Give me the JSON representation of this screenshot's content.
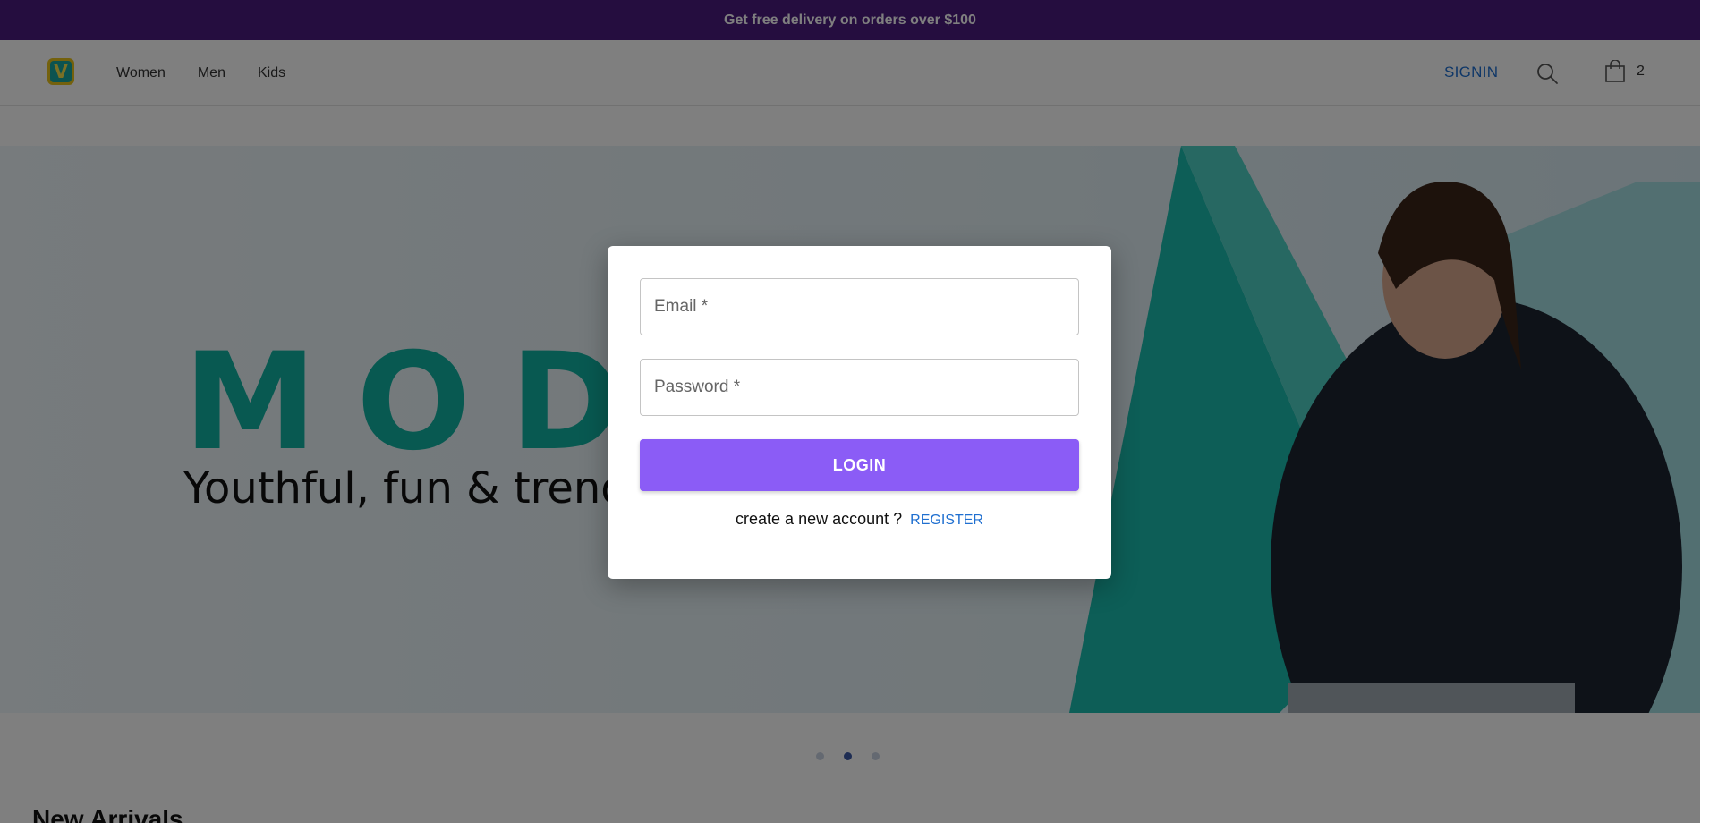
{
  "promo": {
    "text": "Get free delivery on orders over $100"
  },
  "header": {
    "logo_letter": "V",
    "nav": [
      "Women",
      "Men",
      "Kids"
    ],
    "signin_label": "SIGNIN",
    "cart_count": "2"
  },
  "hero": {
    "brand": "MODA",
    "tagline": "Youthful, fun & trendy"
  },
  "carousel": {
    "slides": 3,
    "active_index": 1
  },
  "section": {
    "title": "New Arrivals"
  },
  "login_modal": {
    "email_placeholder": "Email *",
    "password_placeholder": "Password *",
    "login_label": "LOGIN",
    "register_prompt": "create a new account ?",
    "register_label": "REGISTER"
  },
  "colors": {
    "promo_bg": "#4a1a7e",
    "accent_purple": "#8b5cf6",
    "link_blue": "#1f6fd0",
    "brand_teal": "#10b3a2"
  }
}
